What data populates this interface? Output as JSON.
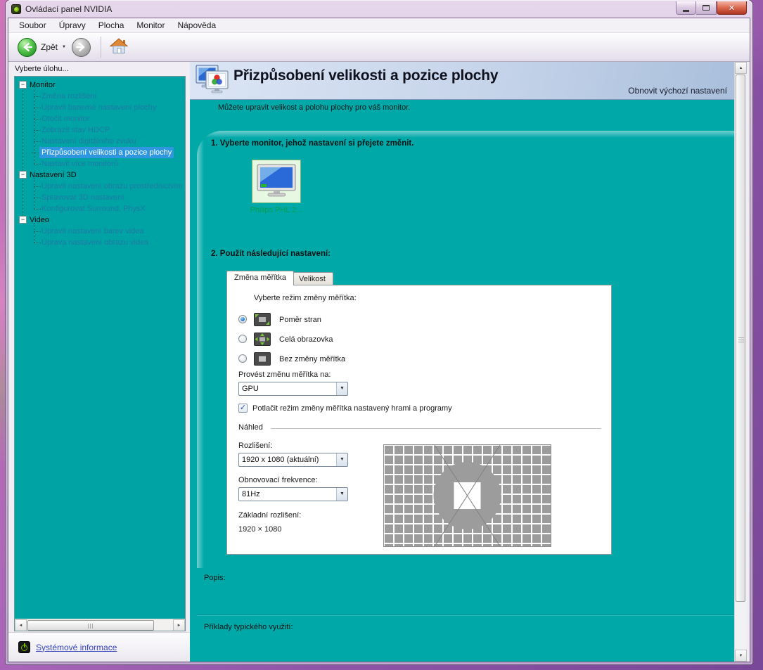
{
  "colors": {
    "teal_background": "#00a8a8",
    "tree_background": "#00a3a3",
    "selection_blue": "#2f97e0",
    "tree_link": "#1e7aa6",
    "banner_gradient_from": "#dbe5f4",
    "banner_gradient_to": "#a9bfdb",
    "monitor_label_green": "#00a050",
    "nvidia_green": "#76b900",
    "footer_link_blue": "#3344bb"
  },
  "icons": {
    "collapse_glyph": "−",
    "close_glyph": "✕",
    "caret_down": "▼",
    "combo_arrow": "▼",
    "check_glyph": "✓",
    "scroll_up": "▲",
    "scroll_down": "▼",
    "scroll_left": "◄",
    "scroll_right": "►"
  },
  "window": {
    "title": "Ovládací panel NVIDIA"
  },
  "menubar": {
    "items": [
      "Soubor",
      "Úpravy",
      "Plocha",
      "Monitor",
      "Nápověda"
    ]
  },
  "toolbar": {
    "back_label": "Zpět"
  },
  "sidebar": {
    "header": "Vyberte úlohu...",
    "groups": [
      {
        "label": "Monitor",
        "children": [
          {
            "label": "Změna rozlišení"
          },
          {
            "label": "Upravit barevné nastavení plochy"
          },
          {
            "label": "Otočit monitor"
          },
          {
            "label": "Zobrazit stav HDCP"
          },
          {
            "label": "Nastavení digitálního zvuku"
          },
          {
            "label": "Přizpůsobení velikosti a pozice plochy",
            "selected": true
          },
          {
            "label": "Nastavit více monitorů"
          }
        ]
      },
      {
        "label": "Nastavení 3D",
        "children": [
          {
            "label": "Upravit nastavení obrazu prostřednictvím n"
          },
          {
            "label": "Spravovat 3D nastavení"
          },
          {
            "label": "Konfigurovat Surround, PhysX"
          }
        ]
      },
      {
        "label": "Video",
        "children": [
          {
            "label": "Upravit nastavení barev videa"
          },
          {
            "label": "Úprava nastavení obrazu videa"
          }
        ]
      }
    ],
    "footer_link": "Systémové informace"
  },
  "main": {
    "title": "Přizpůsobení velikosti a pozice plochy",
    "restore_defaults": "Obnovit výchozí nastavení",
    "subtitle": "Můžete upravit velikost a polohu plochy pro váš monitor.",
    "step1_heading": "1. Vyberte monitor, jehož nastavení si přejete změnit.",
    "monitor_name": "Philips PHL 2...",
    "step2_heading": "2. Použít následující nastavení:",
    "tabs": [
      {
        "label": "Změna měřítka",
        "active": true
      },
      {
        "label": "Velikost",
        "active": false
      }
    ],
    "scaling": {
      "mode_label": "Vyberte režim změny měřítka:",
      "options": [
        {
          "label": "Poměr stran",
          "selected": true
        },
        {
          "label": "Celá obrazovka",
          "selected": false
        },
        {
          "label": "Bez změny měřítka",
          "selected": false
        }
      ],
      "perform_on_label": "Provést změnu měřítka na:",
      "perform_on_value": "GPU",
      "override_label": "Potlačit režim změny měřítka nastavený hrami a programy",
      "override_checked": true
    },
    "preview": {
      "group_label": "Náhled",
      "resolution_label": "Rozlišení:",
      "resolution_value": "1920 x 1080 (aktuální)",
      "refresh_label": "Obnovovací frekvence:",
      "refresh_value": "81Hz",
      "base_resolution_label": "Základní rozlišení:",
      "base_resolution_value": "1920 × 1080"
    },
    "description_label": "Popis:",
    "examples_label": "Příklady typického využití:"
  }
}
